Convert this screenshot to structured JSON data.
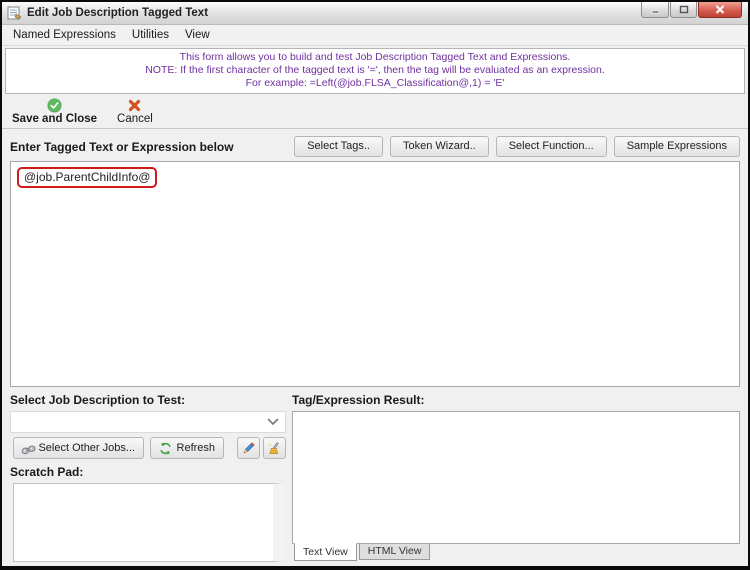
{
  "window": {
    "title": "Edit Job Description Tagged Text"
  },
  "menu": {
    "items": [
      "Named Expressions",
      "Utilities",
      "View"
    ]
  },
  "info_banner": {
    "lines": [
      "This form allows you to build and test Job Description Tagged Text and Expressions.",
      "NOTE: If the first character of the tagged text is '=', then the tag will be evaluated as an expression.",
      "For example: =Left(@job.FLSA_Classification@,1) = 'E'"
    ]
  },
  "toolbar": {
    "save_and_close_label": "Save and Close",
    "cancel_label": "Cancel"
  },
  "editor": {
    "label": "Enter Tagged Text or Expression below",
    "buttons": [
      "Select Tags..",
      "Token Wizard..",
      "Select Function...",
      "Sample Expressions"
    ],
    "content": "@job.ParentChildInfo@"
  },
  "test_section": {
    "label": "Select Job Description to Test:",
    "combobox_value": "",
    "select_other_jobs_label": "Select Other Jobs...",
    "refresh_label": "Refresh",
    "scratch_pad_label": "Scratch Pad:",
    "scratch_pad_value": ""
  },
  "result_section": {
    "label": "Tag/Expression Result:",
    "value": "",
    "tabs": [
      {
        "label": "Text View",
        "active": true
      },
      {
        "label": "HTML View",
        "active": false
      }
    ]
  },
  "colors": {
    "info_text": "#7030a0",
    "tag_highlight_border": "#d11a1a",
    "save_icon_green": "#4fae4f",
    "cancel_icon_orange": "#d2511f",
    "close_button_red": "#c84b3c",
    "refresh_icon_green": "#3da33d",
    "pencil_icon_blue": "#3f7fd1"
  }
}
